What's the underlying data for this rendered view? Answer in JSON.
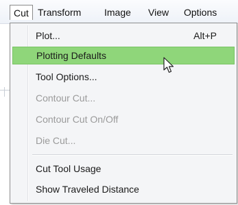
{
  "menubar": {
    "items": [
      {
        "label": "Cut"
      },
      {
        "label": "Transform"
      },
      {
        "label": "Image"
      },
      {
        "label": "View"
      },
      {
        "label": "Options"
      }
    ]
  },
  "dropdown": {
    "items": [
      {
        "label": "Plot...",
        "shortcut": "Alt+P",
        "enabled": true
      },
      {
        "label": "Plotting Defaults",
        "enabled": true,
        "highlighted": true
      },
      {
        "label": "Tool Options...",
        "enabled": true
      },
      {
        "label": "Contour Cut...",
        "enabled": false
      },
      {
        "label": "Contour Cut On/Off",
        "enabled": false
      },
      {
        "label": "Die Cut...",
        "enabled": false
      },
      {
        "label": "Cut Tool Usage",
        "enabled": true
      },
      {
        "label": "Show Traveled Distance",
        "enabled": true
      }
    ]
  },
  "colors": {
    "highlight": "#8fd67a",
    "disabled_text": "#9a9a9a"
  },
  "cursor": {
    "icon": "arrow-pointer-icon"
  }
}
